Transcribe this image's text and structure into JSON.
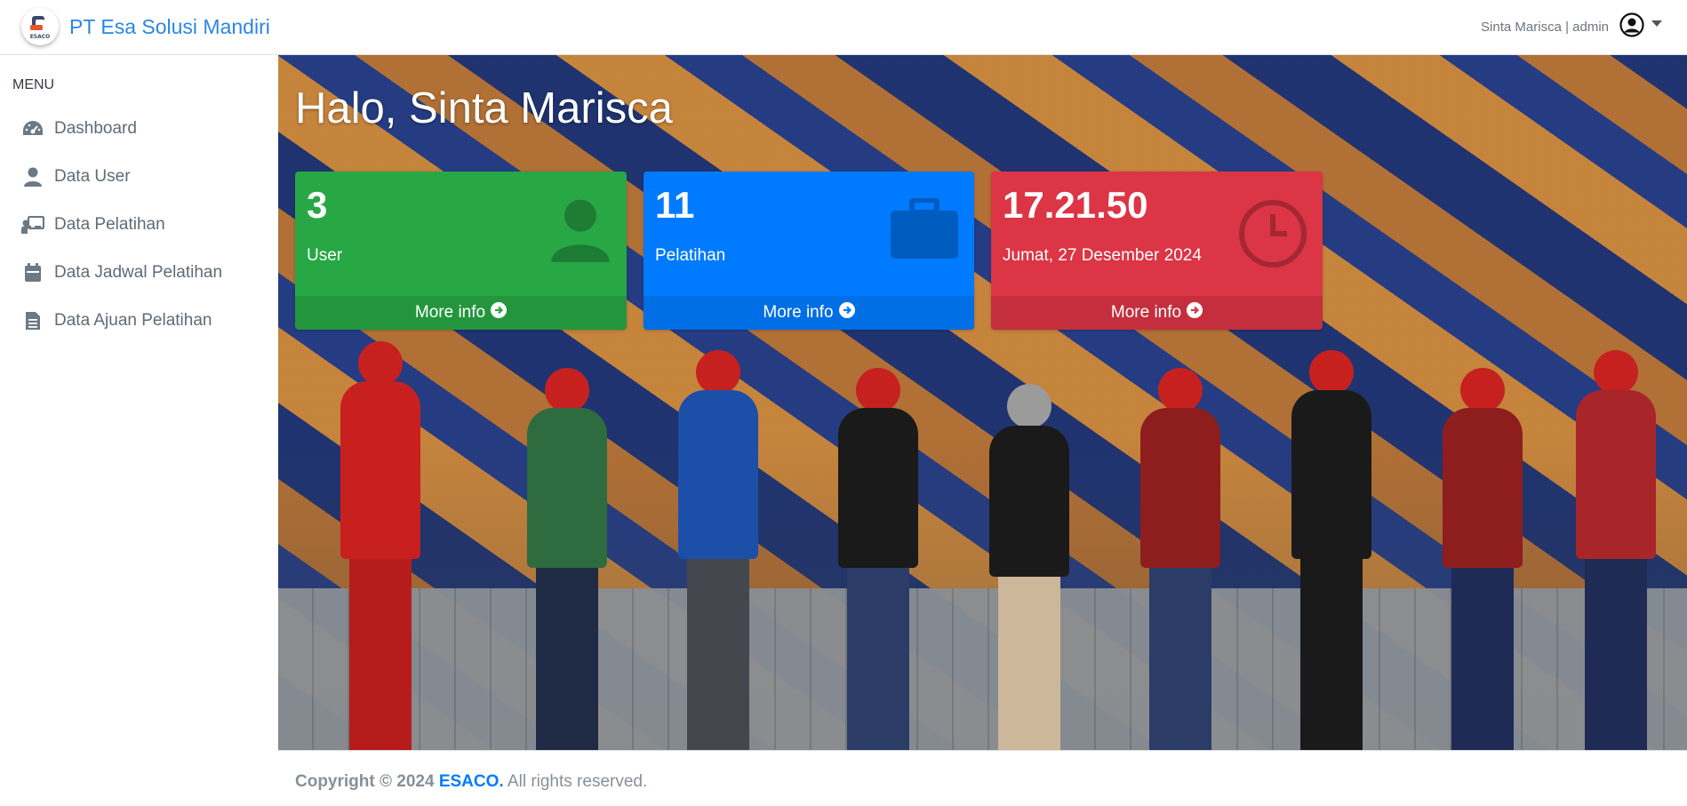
{
  "navbar": {
    "brand_name": "PT Esa Solusi Mandiri",
    "logo_text": "ESACO",
    "user_label": "Sinta Marisca | admin"
  },
  "sidebar": {
    "header": "MENU",
    "items": [
      {
        "label": "Dashboard",
        "icon": "tachometer-icon"
      },
      {
        "label": "Data User",
        "icon": "user-icon"
      },
      {
        "label": "Data Pelatihan",
        "icon": "chalkboard-teacher-icon"
      },
      {
        "label": "Data Jadwal Pelatihan",
        "icon": "calendar-icon"
      },
      {
        "label": "Data Ajuan Pelatihan",
        "icon": "file-alt-icon"
      }
    ]
  },
  "main": {
    "greeting": "Halo, Sinta Marisca",
    "boxes": [
      {
        "value": "3",
        "label": "User",
        "more": "More info",
        "color": "#28a745",
        "icon": "user-icon"
      },
      {
        "value": "11",
        "label": "Pelatihan",
        "more": "More info",
        "color": "#007bff",
        "icon": "briefcase-icon"
      },
      {
        "value": "17.21.50",
        "label": "Jumat, 27 Desember 2024",
        "more": "More info",
        "color": "#dc3545",
        "icon": "clock-icon"
      }
    ]
  },
  "footer": {
    "copyright": "Copyright © 2024",
    "brand": "ESACO.",
    "rights": "All rights reserved."
  },
  "colors": {
    "brand": "#2a87e6",
    "sidebar_text": "#5f6b76",
    "footer_text": "#869099"
  }
}
